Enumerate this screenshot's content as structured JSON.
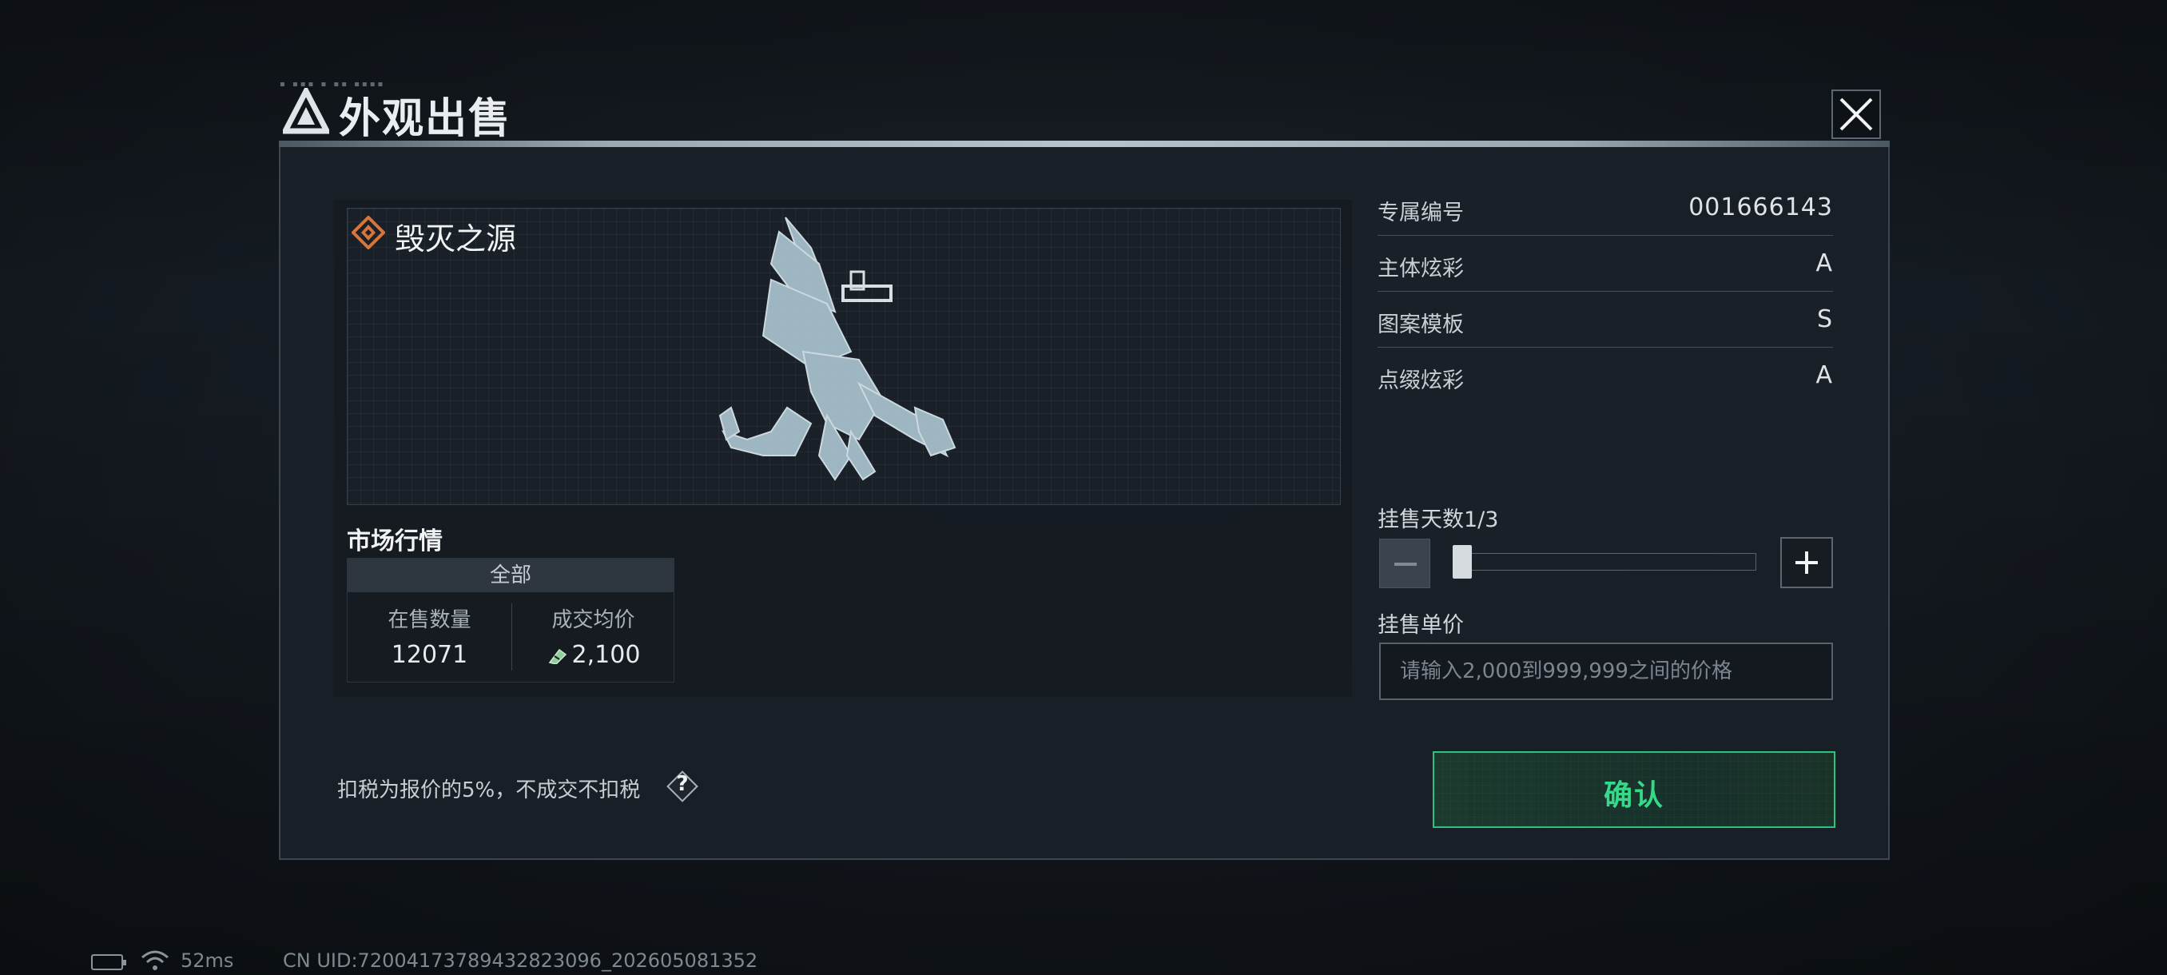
{
  "header": {
    "title": "外观出售"
  },
  "item": {
    "name": "毁灭之源"
  },
  "market": {
    "title": "市场行情",
    "tab": "全部",
    "on_sale_label": "在售数量",
    "on_sale_value": "12071",
    "avg_price_label": "成交均价",
    "avg_price_value": "2,100"
  },
  "info": [
    {
      "label": "专属编号",
      "value": "001666143"
    },
    {
      "label": "主体炫彩",
      "value": "A"
    },
    {
      "label": "图案模板",
      "value": "S"
    },
    {
      "label": "点缀炫彩",
      "value": "A"
    }
  ],
  "listing": {
    "days_label": "挂售天数1/3",
    "days_current": 1,
    "days_max": 3,
    "price_label": "挂售单价",
    "price_placeholder": "请输入2,000到999,999之间的价格",
    "price_value": ""
  },
  "footer": {
    "tax_text": "扣税为报价的5%，不成交不扣税",
    "help_symbol": "?",
    "confirm_label": "确认"
  },
  "status_bar": {
    "ping": "52ms",
    "uid": "CN UID:7200417378943282309​6_202605081352"
  },
  "colors": {
    "accent_green": "#2ec27e",
    "item_icon_orange": "#d9743a",
    "panel_bg": "#1a2028"
  },
  "icons": {
    "logo": "triangle-logo-icon",
    "close": "close-icon",
    "item": "diamond-rarity-icon",
    "currency": "ticket-icon",
    "help": "question-icon"
  }
}
